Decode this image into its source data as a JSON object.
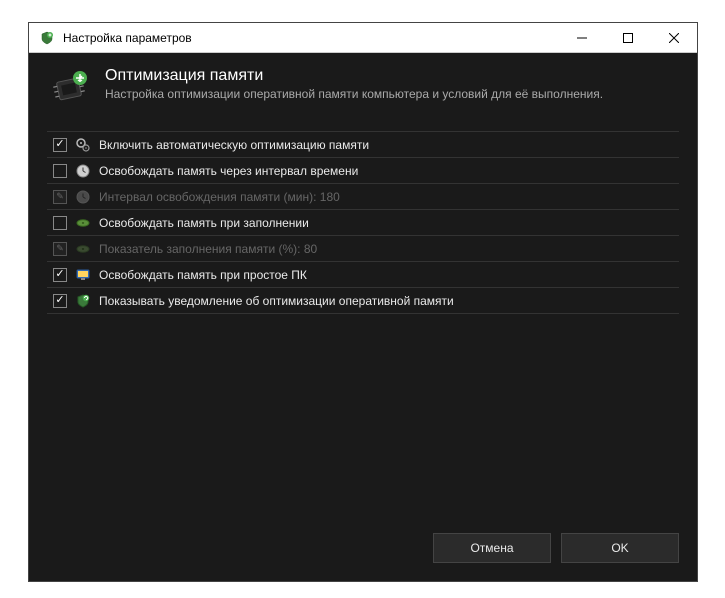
{
  "window": {
    "title": "Настройка параметров"
  },
  "header": {
    "title": "Оптимизация памяти",
    "subtitle": "Настройка оптимизации оперативной памяти компьютера и условий для её выполнения."
  },
  "rows": [
    {
      "label": "Включить автоматическую оптимизацию памяти"
    },
    {
      "label": "Освобождать память через интервал времени"
    },
    {
      "label": "Интервал освобождения памяти (мин): 180"
    },
    {
      "label": "Освобождать память при заполнении"
    },
    {
      "label": "Показатель заполнения памяти (%): 80"
    },
    {
      "label": "Освобождать память при простое ПК"
    },
    {
      "label": "Показывать уведомление об оптимизации оперативной памяти"
    }
  ],
  "footer": {
    "cancel": "Отмена",
    "ok": "OK"
  }
}
